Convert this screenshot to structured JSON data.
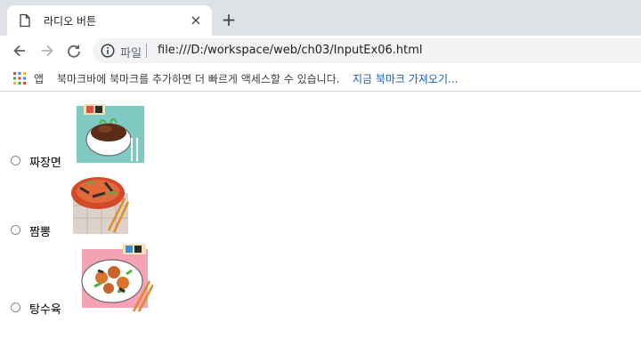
{
  "tab": {
    "title": "라디오 버튼",
    "close": "×",
    "new_tab": "+"
  },
  "toolbar": {
    "scheme": "파일",
    "url": "file:///D:/workspace/web/ch03/InputEx06.html"
  },
  "bookmarks": {
    "apps_label": "앱",
    "hint": "북마크바에 북마크를 추가하면 더 빠르게 액세스할 수 있습니다.",
    "import_link": "지금 북마크 가져오기..."
  },
  "options": [
    {
      "label": "짜장면",
      "image": "jajangmyeon-image",
      "checked": false
    },
    {
      "label": "짬뽕",
      "image": "jjamppong-image",
      "checked": false
    },
    {
      "label": "탕수육",
      "image": "tangsuyuk-image",
      "checked": false
    }
  ]
}
